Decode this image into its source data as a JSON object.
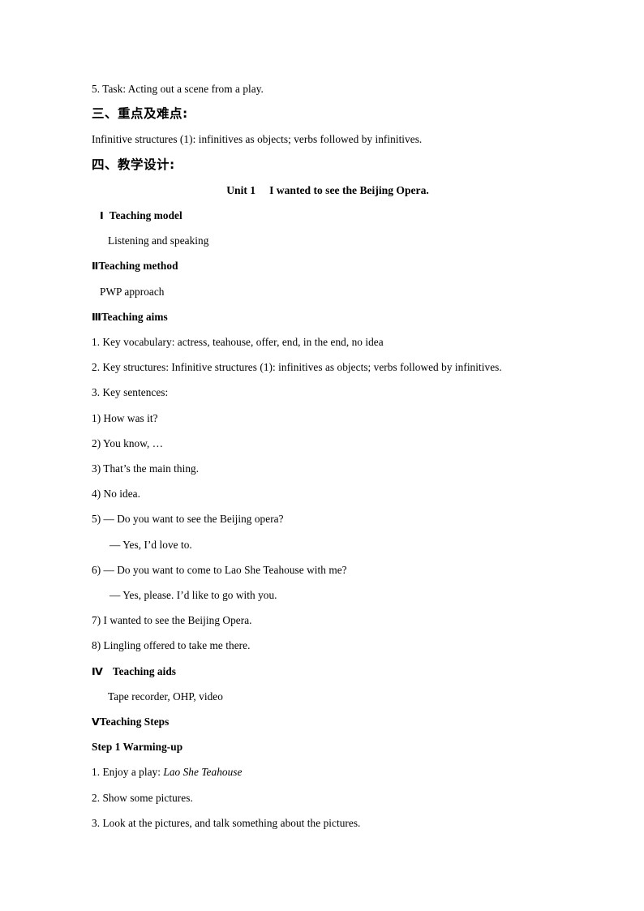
{
  "document": {
    "lines": {
      "task_5": "5. Task: Acting out a scene from a play.",
      "heading_3": "三、重点及难点:",
      "key_difficulty": "Infinitive structures (1): infinitives as objects; verbs followed by infinitives.",
      "heading_4": "四、教学设计:",
      "unit_label": "Unit 1",
      "unit_title": "I wanted to see the Beijing Opera.",
      "roman_1": "Ⅰ",
      "teaching_model_heading": "Teaching model",
      "teaching_model_body": "Listening and speaking",
      "roman_2": "Ⅱ",
      "teaching_method_heading": "Teaching method",
      "teaching_method_body": "PWP approach",
      "roman_3": "Ⅲ",
      "teaching_aims_heading": "Teaching aims",
      "aim_1": "1. Key vocabulary: actress, teahouse, offer, end, in the end, no idea",
      "aim_2": "2. Key structures:  Infinitive structures (1): infinitives as objects; verbs followed by infinitives.",
      "aim_3": "3. Key sentences:",
      "sentence_1": "1) How was it?",
      "sentence_2": "2) You know, …",
      "sentence_3": "3) That’s the main thing.",
      "sentence_4": "4) No idea.",
      "sentence_5": "5) — Do you want to see the Beijing opera?",
      "sentence_5_reply": "— Yes, I’d love to.",
      "sentence_6": "6) — Do you want to come to Lao She Teahouse with me?",
      "sentence_6_reply": "— Yes, please. I’d like to go with you.",
      "sentence_7": "7) I wanted to see the Beijing Opera.",
      "sentence_8": "8) Lingling offered to take me there.",
      "roman_4": "Ⅳ",
      "teaching_aids_heading": "Teaching aids",
      "teaching_aids_body": "Tape recorder, OHP, video",
      "roman_5": "Ⅴ",
      "teaching_steps_heading": "Teaching Steps",
      "step_1_heading": "Step 1 Warming-up",
      "step_1_item_1_prefix": "1. Enjoy a play: ",
      "step_1_item_1_italic": "Lao She Teahouse",
      "step_1_item_2": "2. Show some pictures.",
      "step_1_item_3": "3. Look at the pictures, and talk something about the pictures."
    }
  }
}
